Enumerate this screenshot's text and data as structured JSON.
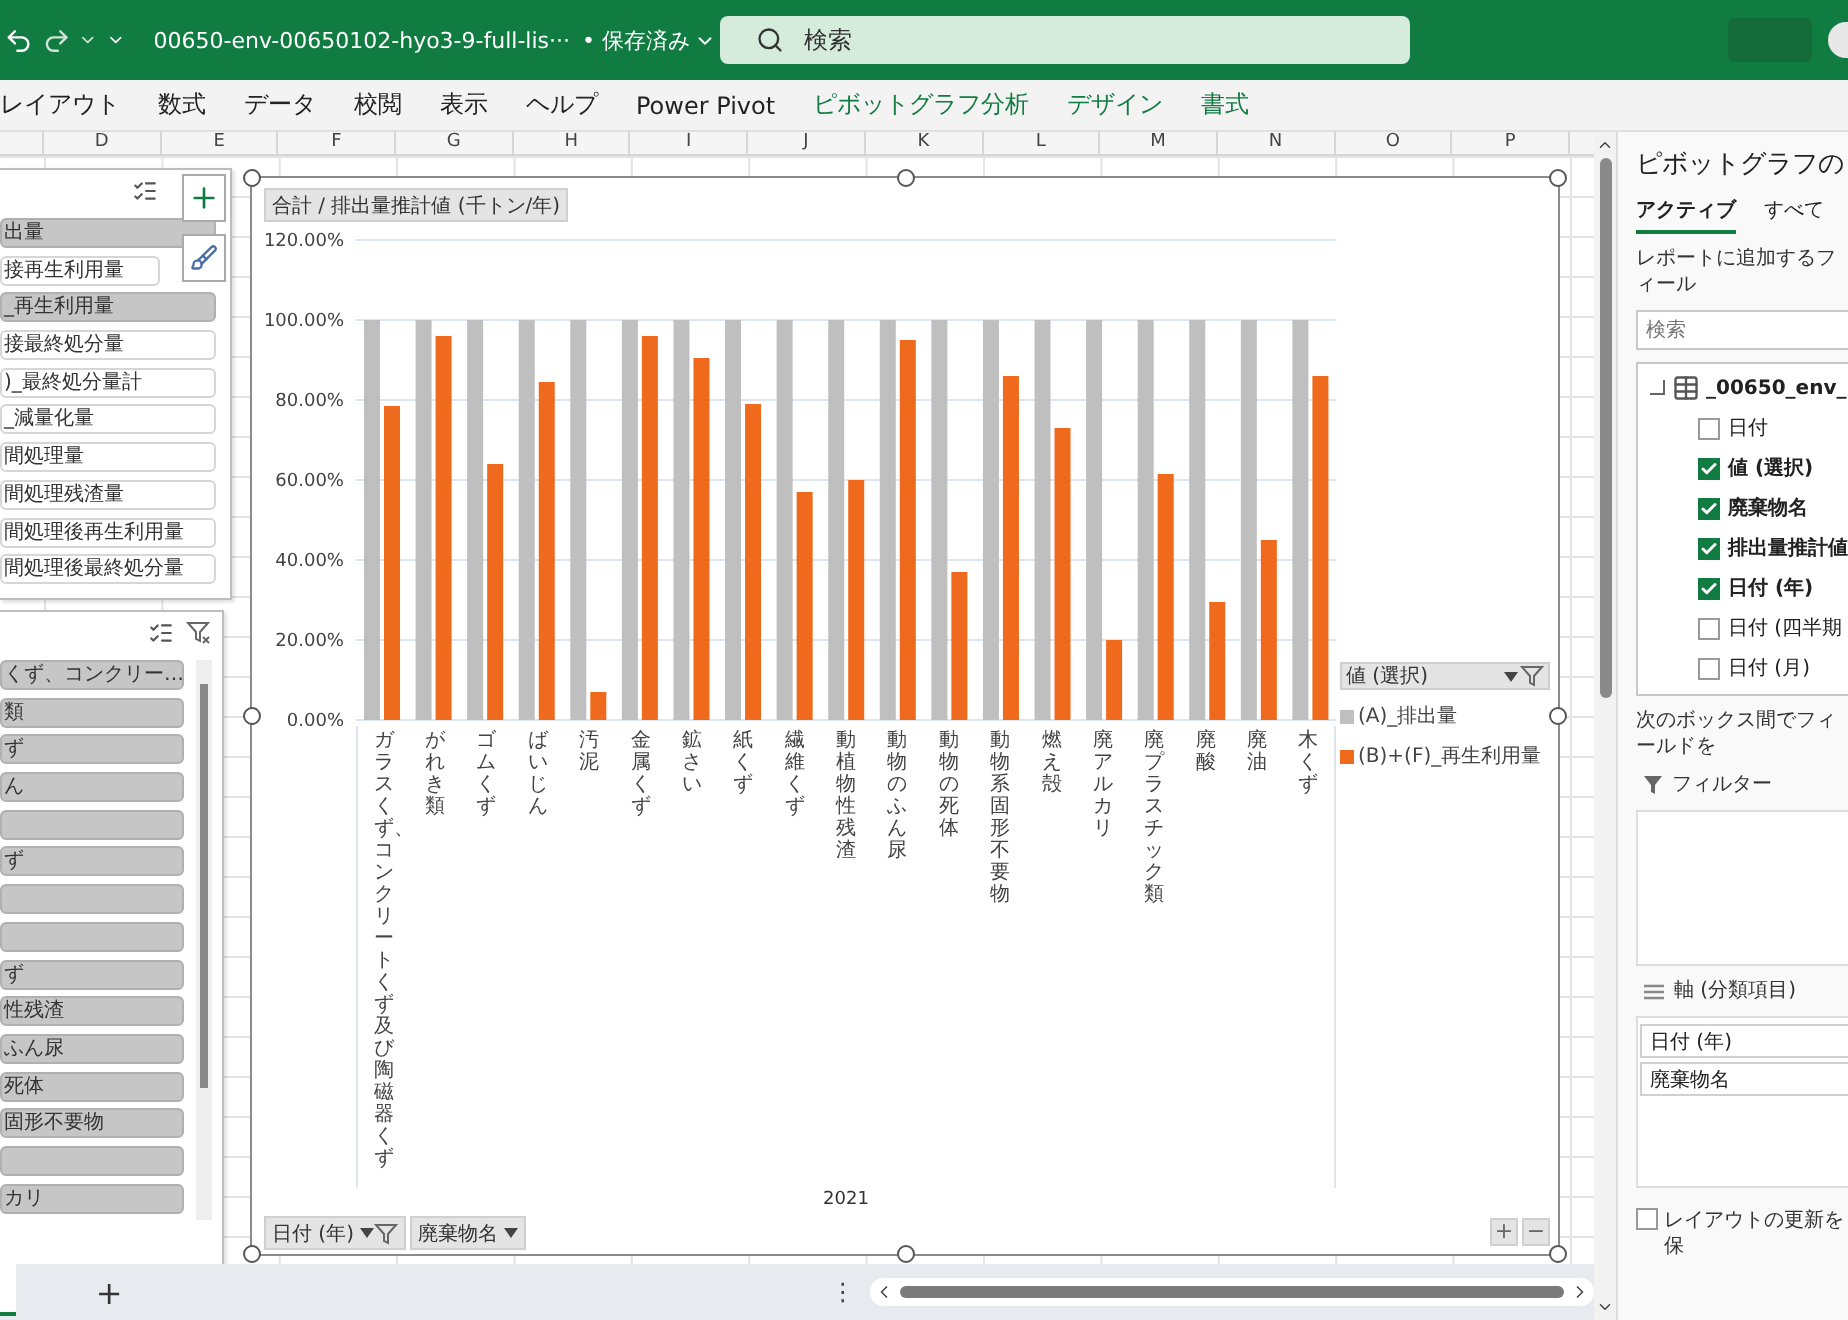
{
  "title_bar": {
    "file_name": "00650-env-00650102-hyo3-9-full-lis···",
    "save_status": "• 保存済み",
    "search": {
      "placeholder": "検索"
    }
  },
  "ribbon_tabs": [
    {
      "label": "レイアウト",
      "kind": "standard"
    },
    {
      "label": "数式",
      "kind": "standard"
    },
    {
      "label": "データ",
      "kind": "standard"
    },
    {
      "label": "校閲",
      "kind": "standard"
    },
    {
      "label": "表示",
      "kind": "standard"
    },
    {
      "label": "ヘルプ",
      "kind": "standard"
    },
    {
      "label": "Power Pivot",
      "kind": "standard"
    },
    {
      "label": "ピボットグラフ分析",
      "kind": "contextual"
    },
    {
      "label": "デザイン",
      "kind": "contextual"
    },
    {
      "label": "書式",
      "kind": "contextual"
    }
  ],
  "column_headers": [
    "D",
    "E",
    "F",
    "G",
    "H",
    "I",
    "J",
    "K",
    "L",
    "M",
    "N",
    "O",
    "P"
  ],
  "slicers": [
    {
      "items": [
        {
          "label": "出量",
          "selected": true
        },
        {
          "label": "接再生利用量",
          "selected": false
        },
        {
          "label": "_再生利用量",
          "selected": true
        },
        {
          "label": "接最終処分量",
          "selected": false
        },
        {
          "label": ")_最終処分量計",
          "selected": false
        },
        {
          "label": "_減量化量",
          "selected": false
        },
        {
          "label": "間処理量",
          "selected": false
        },
        {
          "label": "間処理残渣量",
          "selected": false
        },
        {
          "label": "間処理後再生利用量",
          "selected": false
        },
        {
          "label": "間処理後最終処分量",
          "selected": false
        }
      ]
    },
    {
      "items": [
        {
          "label": "くず、コンクリー…",
          "selected": true
        },
        {
          "label": "類",
          "selected": true
        },
        {
          "label": "ず",
          "selected": true
        },
        {
          "label": "ん",
          "selected": true
        },
        {
          "selected": true
        },
        {
          "label": "ず",
          "selected": true
        },
        {
          "selected": true
        },
        {
          "selected": true
        },
        {
          "label": "ず",
          "selected": true
        },
        {
          "label": "性残渣",
          "selected": true
        },
        {
          "label": "ふん尿",
          "selected": true
        },
        {
          "label": "死体",
          "selected": true
        },
        {
          "label": "固形不要物",
          "selected": true
        },
        {
          "selected": true
        },
        {
          "label": "カリ",
          "selected": true
        }
      ]
    }
  ],
  "chart": {
    "value_field_button": "合計 / 排出量推計値 (千トン/年)",
    "axis_field_buttons": [
      {
        "label": "日付 (年)",
        "kind": "filter"
      },
      {
        "label": "廃棄物名",
        "kind": "dropdown"
      }
    ],
    "legend_title": "値 (選択)",
    "group_label": "2021",
    "zoom_buttons": [
      "+",
      "−"
    ],
    "chart_data": {
      "type": "bar",
      "categories": [
        "ガラスくず、コンクリートくず及び陶磁器くず",
        "がれき類",
        "ゴムくず",
        "ばいじん",
        "汚泥",
        "金属くず",
        "鉱さい",
        "紙くず",
        "繊維くず",
        "動植物性残渣",
        "動物のふん尿",
        "動物の死体",
        "動物系固形不要物",
        "燃え殻",
        "廃アルカリ",
        "廃プラスチック類",
        "廃酸",
        "廃油",
        "木くず"
      ],
      "series": [
        {
          "name": "(A)_排出量",
          "color": "#bfbfbf",
          "values": [
            1,
            1,
            1,
            1,
            1,
            1,
            1,
            1,
            1,
            1,
            1,
            1,
            1,
            1,
            1,
            1,
            1,
            1,
            1
          ]
        },
        {
          "name": "(B)+(F)_再生利用量",
          "color": "#f06a1e",
          "values": [
            0.785,
            0.96,
            0.64,
            0.845,
            0.07,
            0.96,
            0.905,
            0.79,
            0.57,
            0.6,
            0.95,
            0.37,
            0.86,
            0.73,
            0.2,
            0.615,
            0.295,
            0.45,
            0.86
          ]
        }
      ],
      "grid": true,
      "legend": true,
      "ylim": [
        0,
        1.2
      ],
      "yticks": [
        {
          "value": 0,
          "label": "0.00%"
        },
        {
          "value": 0.2,
          "label": "20.00%"
        },
        {
          "value": 0.4,
          "label": "40.00%"
        },
        {
          "value": 0.6,
          "label": "60.00%"
        },
        {
          "value": 0.8,
          "label": "80.00%"
        },
        {
          "value": 1,
          "label": "100.00%"
        },
        {
          "value": 1.2,
          "label": "120.00%"
        }
      ]
    }
  },
  "sheet_bar": {
    "add_sheet": "+",
    "more": "⋮"
  },
  "field_pane": {
    "title": "ピボットグラフの",
    "tabs": [
      {
        "label": "アクティブ",
        "selected": true
      },
      {
        "label": "すべて",
        "selected": false
      }
    ],
    "hint": "レポートに追加するフィール",
    "search": {
      "placeholder": "検索"
    },
    "table_name": "_00650_env_",
    "fields": [
      {
        "label": "日付",
        "checked": false
      },
      {
        "label": "値 (選択)",
        "checked": true
      },
      {
        "label": "廃棄物名",
        "checked": true
      },
      {
        "label": "排出量推計値",
        "checked": true
      },
      {
        "label": "日付 (年)",
        "checked": true
      },
      {
        "label": "日付 (四半期",
        "checked": false
      },
      {
        "label": "日付 (月)",
        "checked": false
      }
    ],
    "areas_hint": "次のボックス間でフィールドを",
    "filter_label": "フィルター",
    "axis_label": "軸 (分類項目)",
    "axis_items": [
      "日付 (年)",
      "廃棄物名"
    ],
    "defer_update": {
      "label": "レイアウトの更新を保",
      "checked": false
    }
  }
}
